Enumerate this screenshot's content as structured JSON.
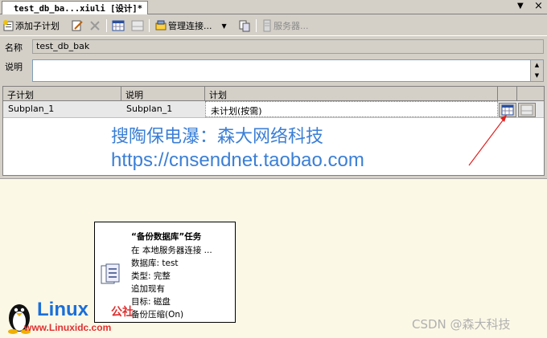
{
  "tab": {
    "title": "test_db_ba...xiuli [设计]*",
    "close": "×",
    "pin": "▼"
  },
  "toolbar": {
    "add_subplan": "添加子计划",
    "manage_connections": "管理连接...",
    "servers": "服务器..."
  },
  "form": {
    "name_label": "名称",
    "name_value": "test_db_bak",
    "desc_label": "说明",
    "desc_value": ""
  },
  "grid": {
    "columns": [
      "子计划",
      "说明",
      "计划"
    ],
    "rows": [
      {
        "subplan": "Subplan_1",
        "description": "Subplan_1",
        "schedule": "未计划(按需)"
      }
    ]
  },
  "watermark": {
    "line1": "搜陶保电瀑：森大网络科技",
    "line2": "https://cnsendnet.taobao.com"
  },
  "task": {
    "title": "“备份数据库”任务",
    "lines": [
      "在 本地服务器连接 ...",
      "数据库: test",
      "类型: 完整",
      "追加现有",
      "目标: 磁盘",
      "备份压缩(On)"
    ]
  },
  "footer": {
    "csdn": "CSDN @森大科技",
    "linux_brand": "Linux",
    "linux_cn": "公社",
    "linux_url": "www.Linuxidc.com"
  },
  "colors": {
    "accent_blue": "#3b7fd6",
    "arrow_red": "#e02020",
    "design_bg": "#fbf8e6"
  }
}
